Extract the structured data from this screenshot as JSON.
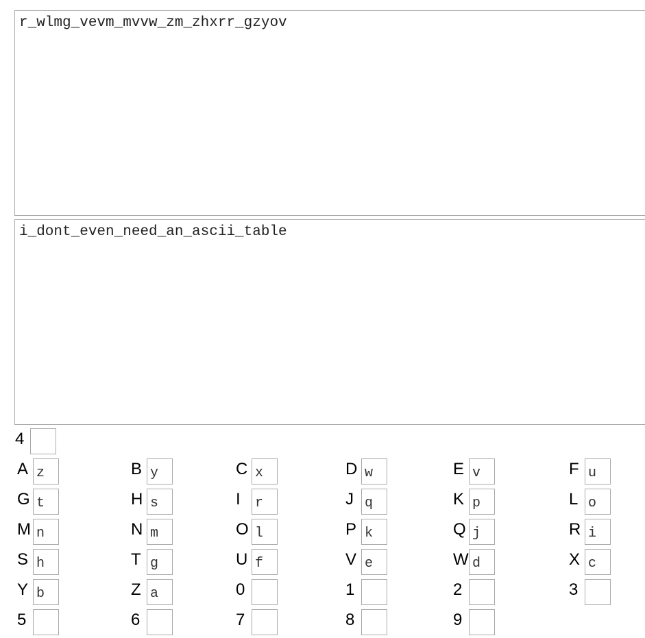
{
  "cipher_text": "r_wlmg_vevm_mvvw_zm_zhxrr_gzyov",
  "plain_text": "i_dont_even_need_an_ascii_table",
  "shift": {
    "label": "4",
    "value": ""
  },
  "mapping": [
    {
      "key": "A",
      "value": "z"
    },
    {
      "key": "B",
      "value": "y"
    },
    {
      "key": "C",
      "value": "x"
    },
    {
      "key": "D",
      "value": "w"
    },
    {
      "key": "E",
      "value": "v"
    },
    {
      "key": "F",
      "value": "u"
    },
    {
      "key": "G",
      "value": "t"
    },
    {
      "key": "H",
      "value": "s"
    },
    {
      "key": "I",
      "value": "r"
    },
    {
      "key": "J",
      "value": "q"
    },
    {
      "key": "K",
      "value": "p"
    },
    {
      "key": "L",
      "value": "o"
    },
    {
      "key": "M",
      "value": "n"
    },
    {
      "key": "N",
      "value": "m"
    },
    {
      "key": "O",
      "value": "l"
    },
    {
      "key": "P",
      "value": "k"
    },
    {
      "key": "Q",
      "value": "j"
    },
    {
      "key": "R",
      "value": "i"
    },
    {
      "key": "S",
      "value": "h"
    },
    {
      "key": "T",
      "value": "g"
    },
    {
      "key": "U",
      "value": "f"
    },
    {
      "key": "V",
      "value": "e"
    },
    {
      "key": "W",
      "value": "d"
    },
    {
      "key": "X",
      "value": "c"
    },
    {
      "key": "Y",
      "value": "b"
    },
    {
      "key": "Z",
      "value": "a"
    },
    {
      "key": "0",
      "value": ""
    },
    {
      "key": "1",
      "value": ""
    },
    {
      "key": "2",
      "value": ""
    },
    {
      "key": "3",
      "value": ""
    },
    {
      "key": "5",
      "value": ""
    },
    {
      "key": "6",
      "value": ""
    },
    {
      "key": "7",
      "value": ""
    },
    {
      "key": "8",
      "value": ""
    },
    {
      "key": "9",
      "value": ""
    }
  ]
}
